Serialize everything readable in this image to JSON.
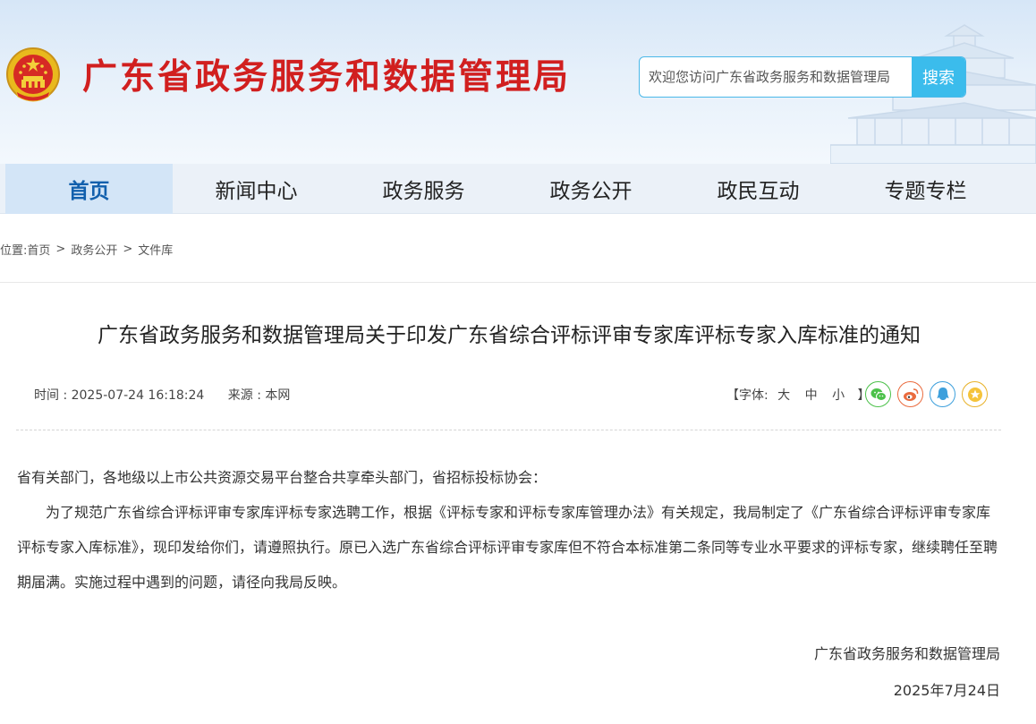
{
  "header": {
    "site_title": "广东省政务服务和数据管理局",
    "search": {
      "placeholder": "欢迎您访问广东省政务服务和数据管理局",
      "button_label": "搜索"
    }
  },
  "nav": {
    "items": [
      {
        "label": "首页",
        "active": true
      },
      {
        "label": "新闻中心",
        "active": false
      },
      {
        "label": "政务服务",
        "active": false
      },
      {
        "label": "政务公开",
        "active": false
      },
      {
        "label": "政民互动",
        "active": false
      },
      {
        "label": "专题专栏",
        "active": false
      }
    ]
  },
  "breadcrumb": {
    "lead": "位置:",
    "items": [
      "首页",
      "政务公开",
      "文件库"
    ],
    "separator": ">"
  },
  "article": {
    "title": "广东省政务服务和数据管理局关于印发广东省综合评标评审专家库评标专家入库标准的通知",
    "meta": {
      "time": "时间 : 2025-07-24 16:18:24",
      "source": "来源 : 本网"
    },
    "font_size_control": {
      "prefix": "【字体:",
      "options": [
        "大",
        "中",
        "小"
      ],
      "suffix": "】"
    },
    "share_icons": [
      "wechat-icon",
      "weibo-icon",
      "qq-icon",
      "favorite-icon"
    ],
    "salutation": "省有关部门，各地级以上市公共资源交易平台整合共享牵头部门，省招标投标协会：",
    "paragraph": "为了规范广东省综合评标评审专家库评标专家选聘工作，根据《评标专家和评标专家库管理办法》有关规定，我局制定了《广东省综合评标评审专家库评标专家入库标准》，现印发给你们，请遵照执行。原已入选广东省综合评标评审专家库但不符合本标准第二条同等专业水平要求的评标专家，继续聘任至聘期届满。实施过程中遇到的问题，请径向我局反映。",
    "signature_org": "广东省政务服务和数据管理局",
    "signature_date": "2025年7月24日"
  },
  "colors": {
    "title_red": "#d11f1f",
    "nav_active_text": "#1260ad",
    "nav_bg": "#ebf1f8",
    "nav_active_bg": "#d3e5f7",
    "search_button": "#3bbcec",
    "wechat": "#4cc14a",
    "weibo": "#ea6b3e",
    "qq": "#3ea0dc",
    "favorite": "#e8b22a"
  }
}
